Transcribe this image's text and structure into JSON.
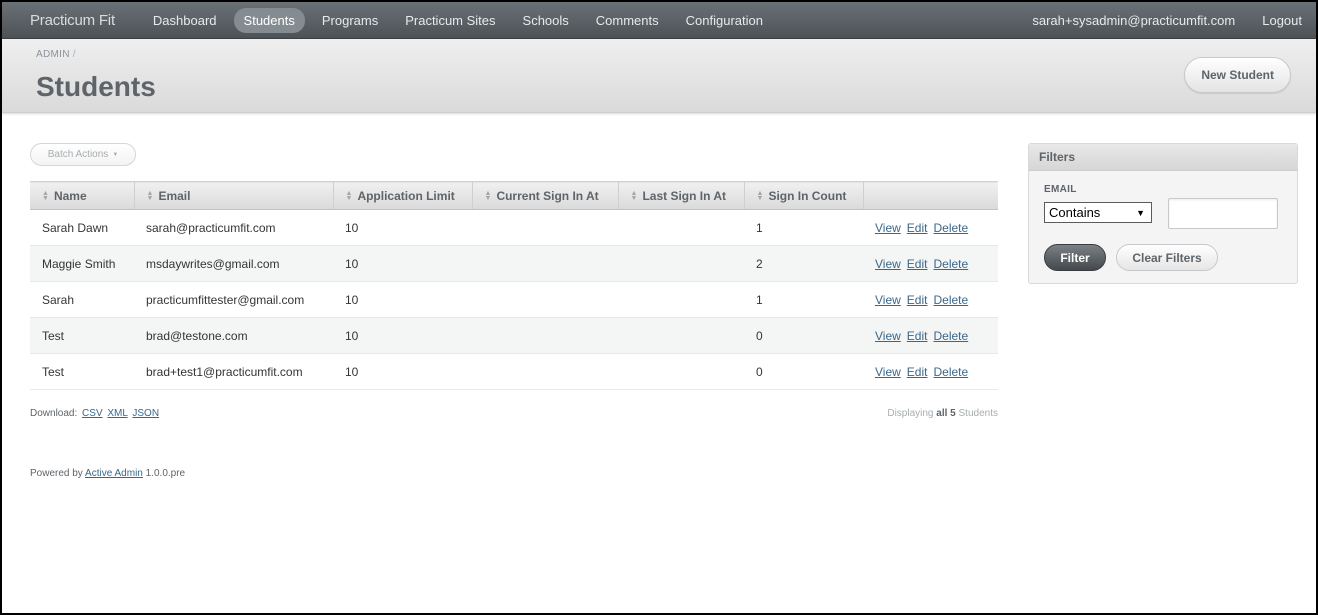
{
  "header": {
    "brand": "Practicum Fit",
    "nav": [
      {
        "label": "Dashboard",
        "active": false
      },
      {
        "label": "Students",
        "active": true
      },
      {
        "label": "Programs",
        "active": false
      },
      {
        "label": "Practicum Sites",
        "active": false
      },
      {
        "label": "Schools",
        "active": false
      },
      {
        "label": "Comments",
        "active": false
      },
      {
        "label": "Configuration",
        "active": false
      }
    ],
    "user_email": "sarah+sysadmin@practicumfit.com",
    "logout": "Logout"
  },
  "titlebar": {
    "breadcrumb": "ADMIN",
    "breadcrumb_sep": "/",
    "title": "Students",
    "new_button": "New Student"
  },
  "batch_actions": "Batch Actions",
  "table": {
    "columns": [
      "Name",
      "Email",
      "Application Limit",
      "Current Sign In At",
      "Last Sign In At",
      "Sign In Count",
      ""
    ],
    "rows": [
      {
        "name": "Sarah Dawn",
        "email": "sarah@practicumfit.com",
        "limit": "10",
        "current": "",
        "last": "",
        "count": "1"
      },
      {
        "name": "Maggie Smith",
        "email": "msdaywrites@gmail.com",
        "limit": "10",
        "current": "",
        "last": "",
        "count": "2"
      },
      {
        "name": "Sarah",
        "email": "practicumfittester@gmail.com",
        "limit": "10",
        "current": "",
        "last": "",
        "count": "1"
      },
      {
        "name": "Test",
        "email": "brad@testone.com",
        "limit": "10",
        "current": "",
        "last": "",
        "count": "0"
      },
      {
        "name": "Test",
        "email": "brad+test1@practicumfit.com",
        "limit": "10",
        "current": "",
        "last": "",
        "count": "0"
      }
    ],
    "actions": {
      "view": "View",
      "edit": "Edit",
      "delete": "Delete"
    }
  },
  "download": {
    "label": "Download:",
    "links": [
      "CSV",
      "XML",
      "JSON"
    ]
  },
  "pagination": {
    "prefix": "Displaying",
    "all": "all 5",
    "suffix": "Students"
  },
  "footer": {
    "prefix": "Powered by",
    "link": "Active Admin",
    "version": "1.0.0.pre"
  },
  "sidebar": {
    "title": "Filters",
    "field_label": "EMAIL",
    "select_value": "Contains",
    "input_value": "",
    "filter_button": "Filter",
    "clear_button": "Clear Filters"
  },
  "colors": {
    "link": "#38678b",
    "header_bg": "#5e6469"
  }
}
